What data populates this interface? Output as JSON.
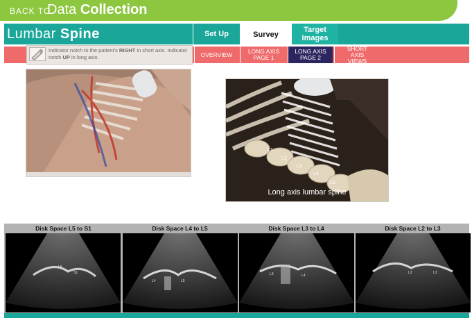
{
  "header": {
    "back_label": "BACK TO",
    "section_title_light": "Data",
    "section_title_bold": "Collection"
  },
  "title_row": {
    "title_light": "Lumbar",
    "title_bold": "Spine",
    "tabs": [
      {
        "label": "Set Up"
      },
      {
        "label": "Survey"
      },
      {
        "label": "Target Images"
      }
    ]
  },
  "instruction": {
    "part1": "Indicator notch to the patient's ",
    "bold1": "RIGHT",
    "part2": " in short axis. Indicator notch ",
    "bold2": "UP",
    "part3": " in long axis."
  },
  "sub_tabs": [
    {
      "label": "OVERVIEW"
    },
    {
      "label": "LONG AXIS PAGE 1"
    },
    {
      "label": "LONG AXIS PAGE 2"
    },
    {
      "label": "SHORT AXIS VIEWS"
    }
  ],
  "figure_right": {
    "caption": "Long axis lumbar spine",
    "vertebra_labels": [
      "L1",
      "L2",
      "L3",
      "L4",
      "L5"
    ]
  },
  "ultrasound": {
    "panels": [
      {
        "title": "Disk Space L5 to S1",
        "labels": [
          "L5",
          "S1"
        ]
      },
      {
        "title": "Disk Space L4 to L5",
        "labels": [
          "L4",
          "L5"
        ]
      },
      {
        "title": "Disk Space L3 to L4",
        "labels": [
          "L3",
          "L4"
        ]
      },
      {
        "title": "Disk Space L2 to L3",
        "labels": [
          "L2",
          "L3"
        ]
      }
    ]
  },
  "colors": {
    "green": "#8dc63f",
    "teal": "#1aa79a",
    "salmon": "#ef6b6b",
    "navy": "#2b2660"
  }
}
